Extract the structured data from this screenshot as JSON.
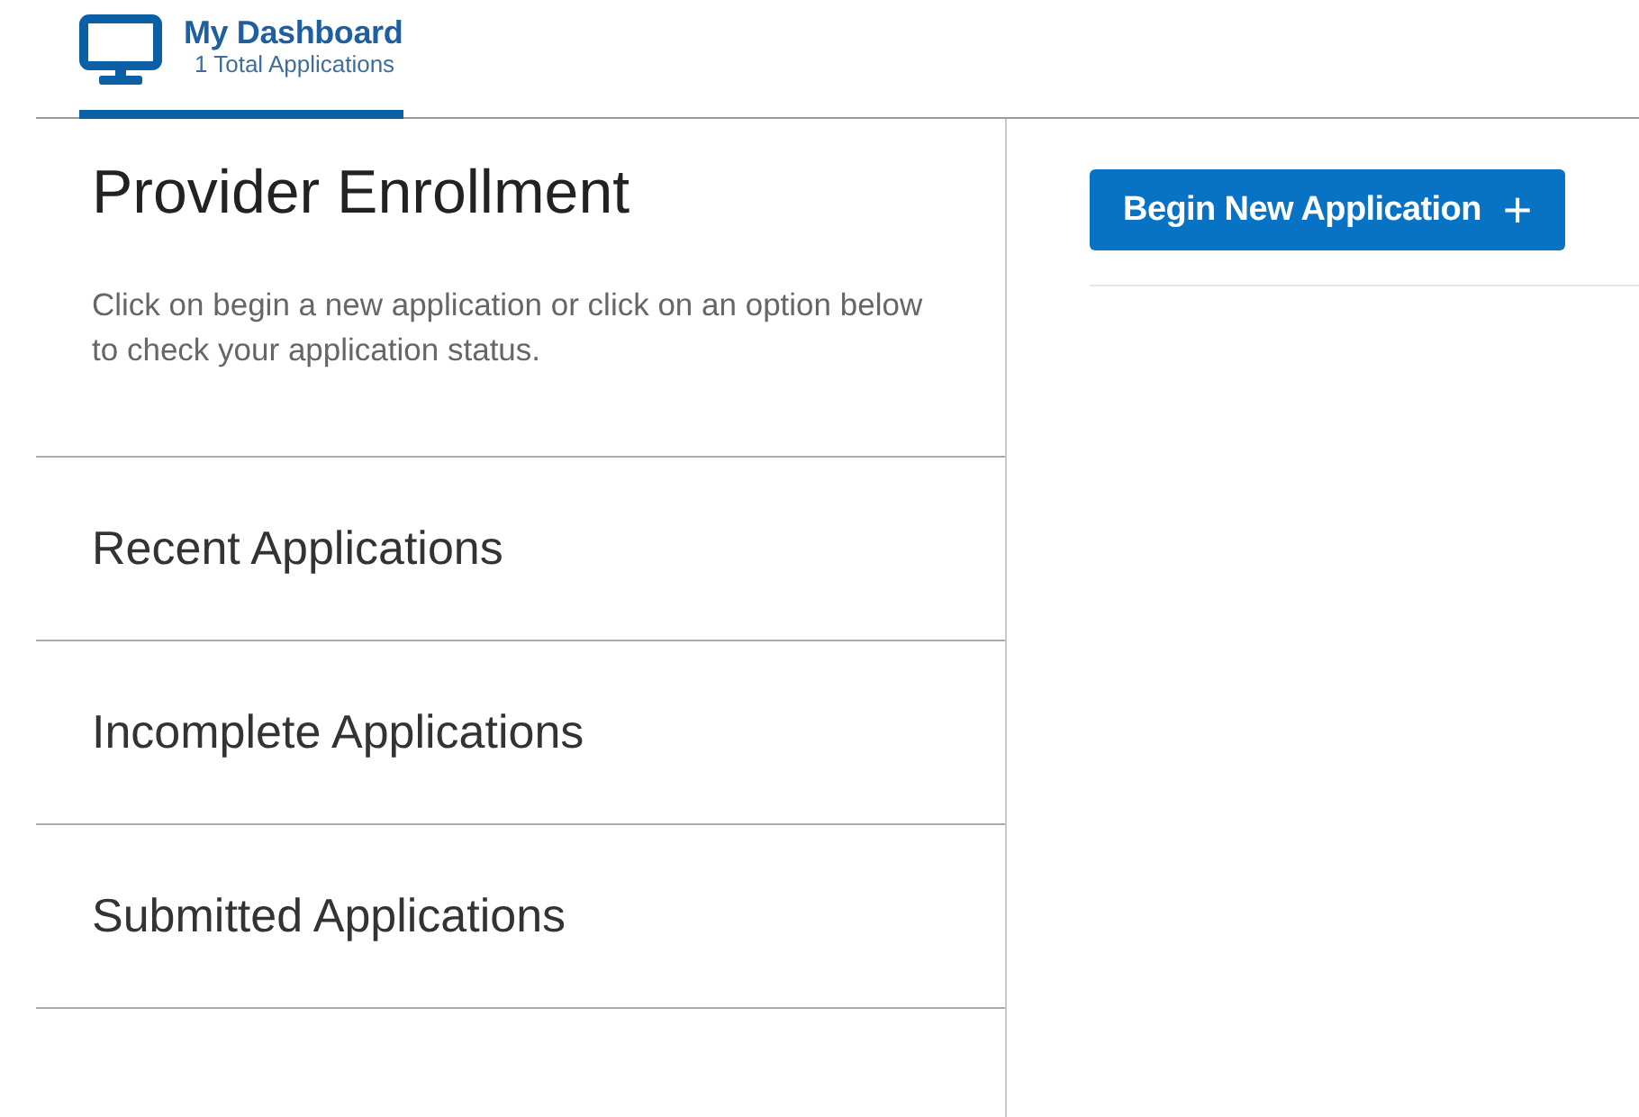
{
  "header_tab": {
    "title": "My Dashboard",
    "subtitle": "1 Total Applications",
    "selected": true
  },
  "page": {
    "title": "Provider Enrollment",
    "description": "Click on begin a new application or click on an option below to check your application status."
  },
  "options": [
    {
      "label": "Recent Applications"
    },
    {
      "label": "Incomplete Applications"
    },
    {
      "label": "Submitted Applications"
    }
  ],
  "button": {
    "label": "Begin New Application",
    "icon": "+"
  }
}
